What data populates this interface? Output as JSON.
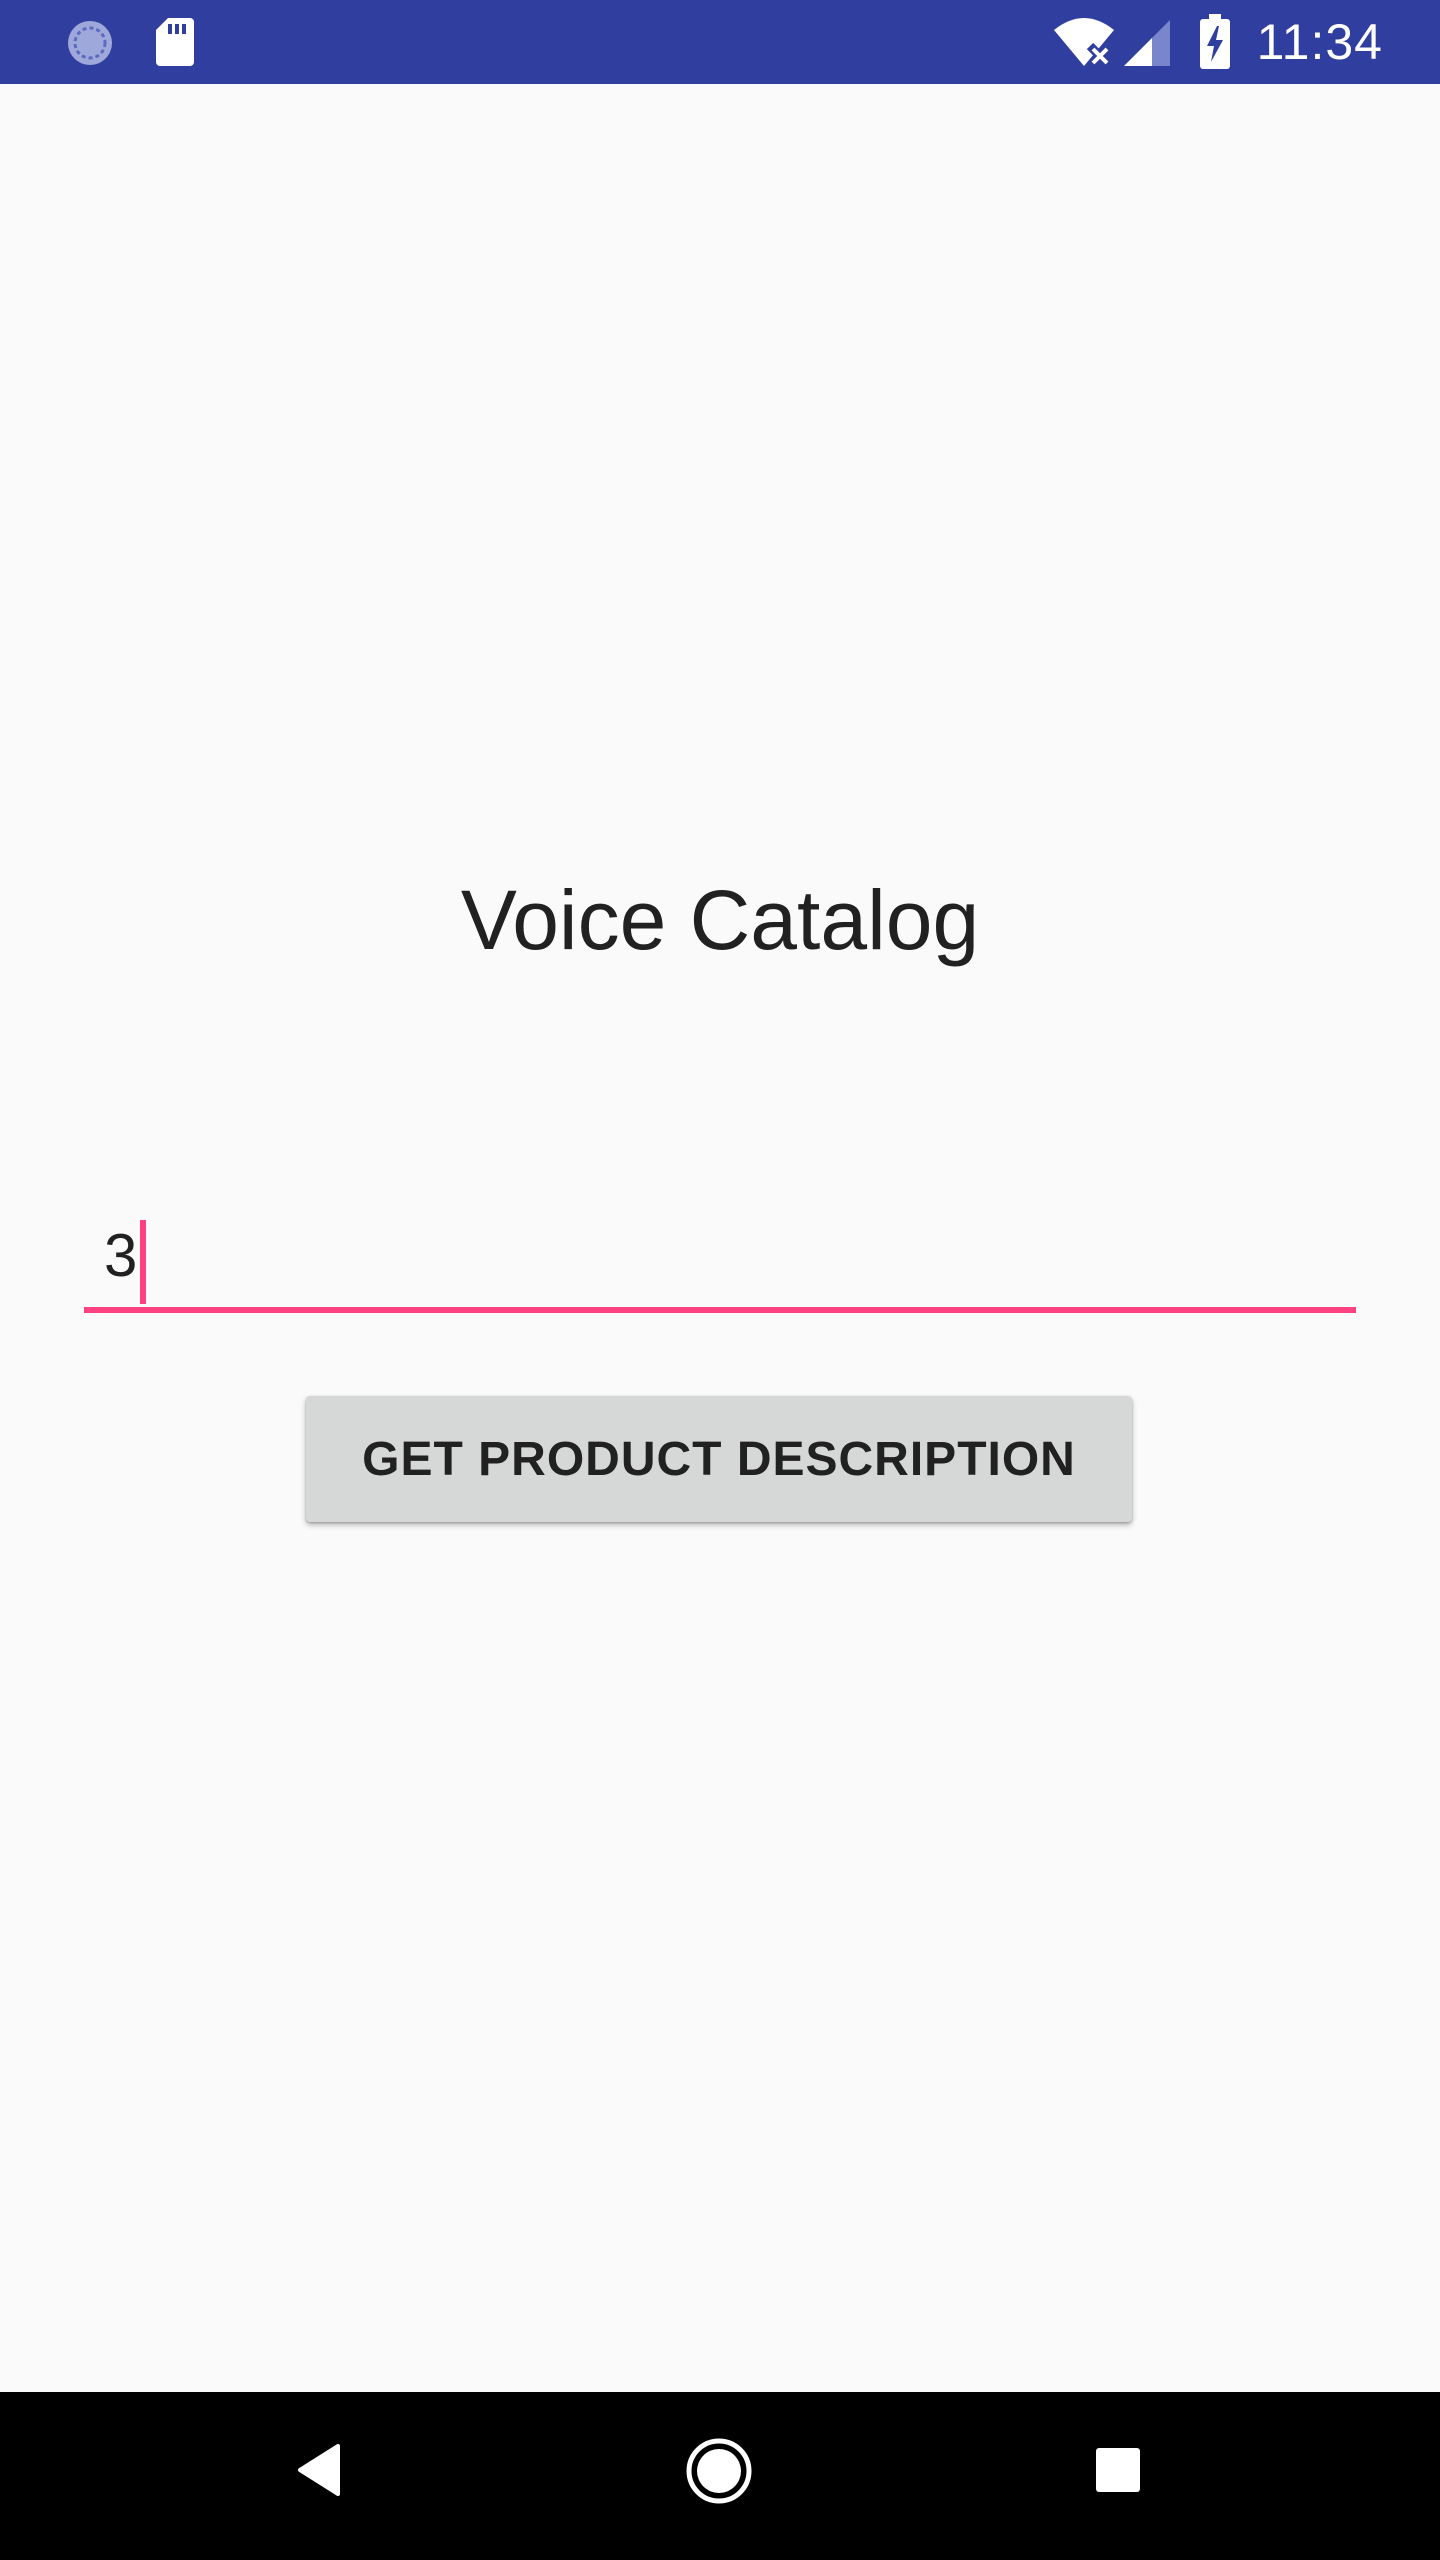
{
  "status_bar": {
    "time": "11:34",
    "color": "#303f9f",
    "icons": [
      "sync-icon",
      "sd-card-icon",
      "wifi-off-icon",
      "cell-signal-icon",
      "battery-charging-icon"
    ]
  },
  "main": {
    "title": "Voice Catalog",
    "input": {
      "value": "3",
      "accent_color": "#ff4081"
    },
    "button": {
      "label": "GET PRODUCT DESCRIPTION"
    }
  },
  "nav_bar": {
    "icons": [
      "back-icon",
      "home-icon",
      "recents-icon"
    ]
  }
}
